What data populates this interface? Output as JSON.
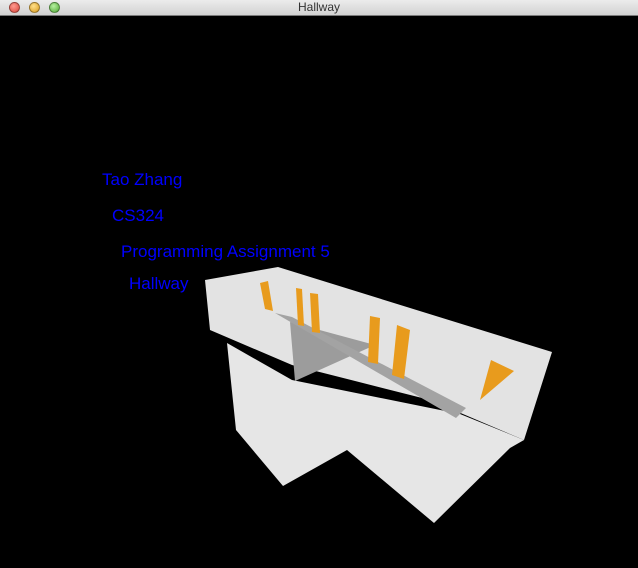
{
  "window": {
    "title": "Hallway",
    "buttons": [
      "close",
      "minimize",
      "zoom"
    ]
  },
  "overlay_text": {
    "line1": "Tao Zhang",
    "line2": "CS324",
    "line3": "Programming Assignment 5",
    "line4": "Hallway"
  },
  "colors": {
    "background": "#000000",
    "text": "#0000ff",
    "walls": "#e6e6e6",
    "floor": "#a0a0a0",
    "doors": "#e89b1d"
  }
}
